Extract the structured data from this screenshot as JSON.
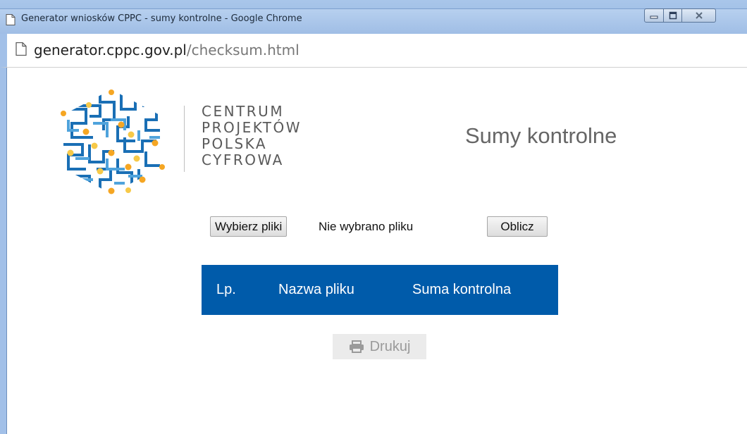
{
  "window": {
    "title": "Generator wniosków CPPC - sumy kontrolne - Google Chrome",
    "controls": {
      "minimize_icon": "minimize-icon",
      "maximize_icon": "maximize-icon",
      "close_icon": "close-icon"
    }
  },
  "addressbar": {
    "domain": "generator.cppc.gov.pl",
    "path": "/checksum.html",
    "page_icon": "page-icon"
  },
  "logo": {
    "lines": [
      "CENTRUM",
      "PROJEKTÓW",
      "POLSKA",
      "CYFROWA"
    ],
    "colors": {
      "blue": "#1a6fb5",
      "light_blue": "#4fa3dc",
      "orange": "#f5a623",
      "yellow": "#f7c948"
    }
  },
  "page": {
    "title": "Sumy kontrolne"
  },
  "file_input": {
    "button_label": "Wybierz pliki",
    "status": "Nie wybrano pliku"
  },
  "calculate_button": {
    "label": "Oblicz"
  },
  "table": {
    "columns": [
      "Lp.",
      "Nazwa pliku",
      "Suma kontrolna"
    ],
    "header_color": "#005baa",
    "rows": []
  },
  "print_button": {
    "label": "Drukuj",
    "icon": "print-icon"
  }
}
